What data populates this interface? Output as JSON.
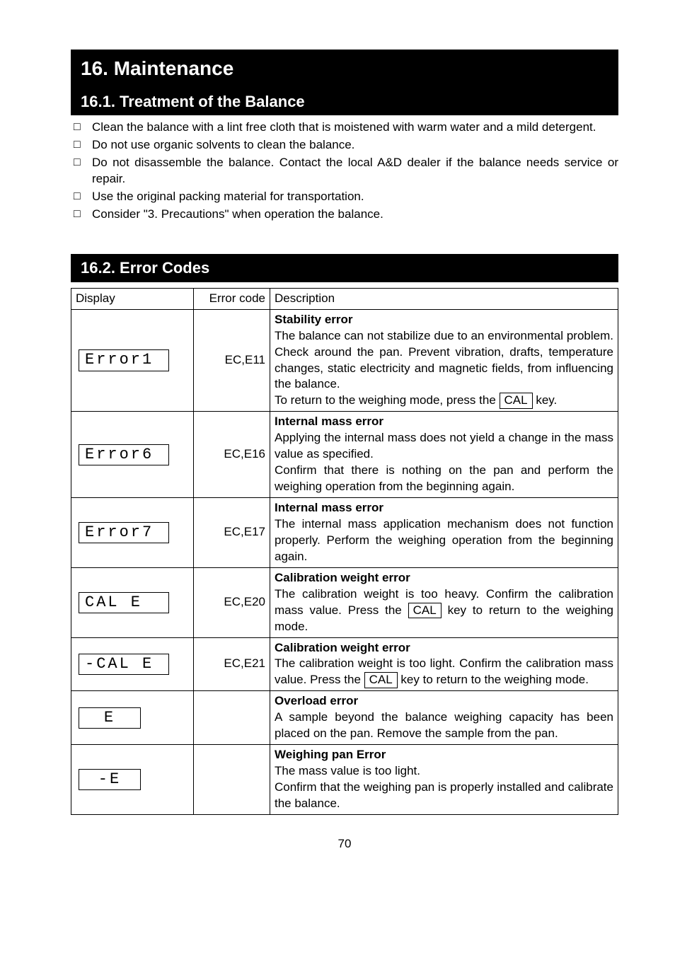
{
  "headings": {
    "h1": "16. Maintenance",
    "h2a": "16.1. Treatment of the Balance",
    "h2b": "16.2. Error Codes"
  },
  "bullets": [
    "Clean the balance with a lint free cloth that is moistened with warm water and a mild detergent.",
    "Do not use organic solvents to clean the balance.",
    "Do not disassemble the balance. Contact the local A&D dealer if the balance needs service or repair.",
    "Use the original packing material for transportation.",
    "Consider \"3. Precautions\" when operation the balance."
  ],
  "tableHeader": {
    "display": "Display",
    "code": "Error code",
    "desc": "Description"
  },
  "rows": [
    {
      "disp": "Error1",
      "code": "EC,E11",
      "title": "Stability error",
      "body1": "The balance can not stabilize due to an environmental problem. Check around the pan. Prevent vibration, drafts, temperature changes, static electricity and magnetic fields, from influencing the balance.",
      "body2_pre": "To return to the weighing mode, press the ",
      "key": " CAL ",
      "body2_post": " key."
    },
    {
      "disp": "Error6",
      "code": "EC,E16",
      "title": "Internal mass error",
      "body1": "Applying the internal mass does not yield a change in the mass value as specified.",
      "body2": "Confirm that there is nothing on the pan and perform the weighing operation from the beginning again."
    },
    {
      "disp": "Error7",
      "code": "EC,E17",
      "title": "Internal mass error",
      "body1": "The internal mass application mechanism does not function properly. Perform the weighing operation from the beginning again."
    },
    {
      "disp": "CAL E",
      "code": "EC,E20",
      "title": "Calibration weight error",
      "body_pre": "The calibration weight is too heavy. Confirm the calibration mass value. Press the ",
      "key": " CAL ",
      "body_post": " key to return to the weighing mode."
    },
    {
      "disp": "-CAL E",
      "code": "EC,E21",
      "title": "Calibration weight error",
      "body_pre": "The calibration weight is too light. Confirm the calibration mass value. Press the ",
      "key": " CAL ",
      "body_post": " key to return to the weighing mode."
    },
    {
      "disp": "E",
      "code": "",
      "title": "Overload error",
      "body1": "A sample beyond the balance weighing capacity has been placed on the pan. Remove the sample from the pan."
    },
    {
      "disp": "-E",
      "code": "",
      "title": "Weighing pan Error",
      "body1": "The mass value is too light.",
      "body2": "Confirm that the weighing pan is properly installed and calibrate the balance."
    }
  ],
  "pageNumber": "70"
}
